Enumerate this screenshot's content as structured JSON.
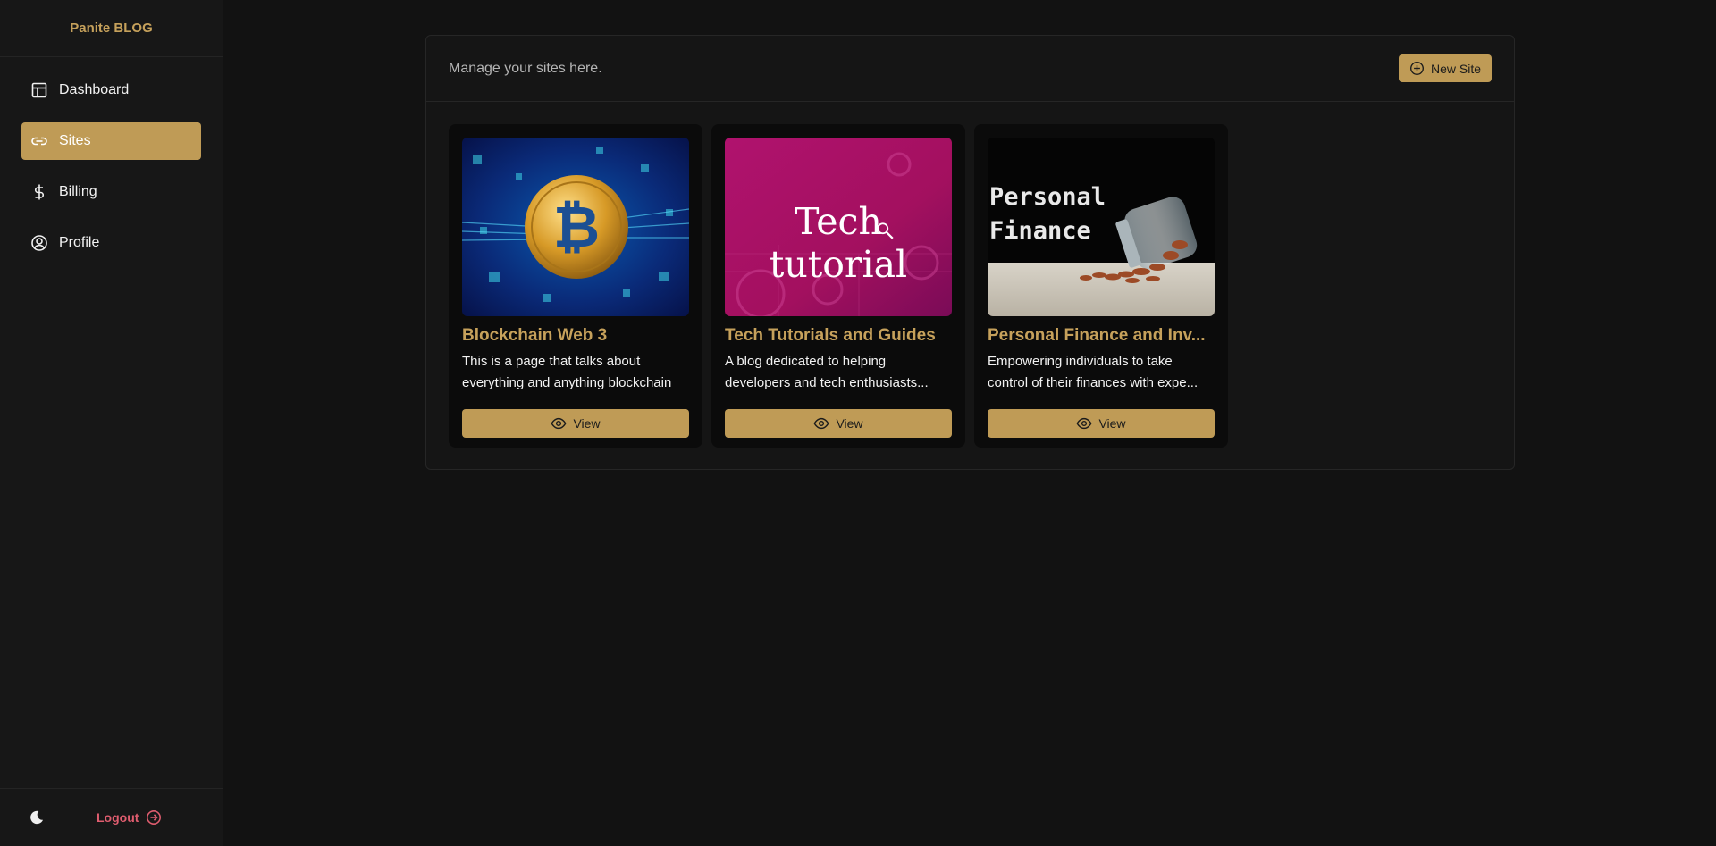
{
  "brand": "Panite BLOG",
  "colors": {
    "accent": "#bf9b56",
    "title_gold": "#c6a15b",
    "logout": "#e05d6f",
    "background": "#121212"
  },
  "sidebar": {
    "items": [
      {
        "label": "Dashboard",
        "icon": "layout-icon",
        "active": false
      },
      {
        "label": "Sites",
        "icon": "link-icon",
        "active": true
      },
      {
        "label": "Billing",
        "icon": "dollar-icon",
        "active": false
      },
      {
        "label": "Profile",
        "icon": "user-circle-icon",
        "active": false
      }
    ],
    "footer": {
      "theme_icon": "moon-icon",
      "logout_label": "Logout",
      "logout_icon": "arrow-right-circle-icon"
    }
  },
  "main": {
    "subtitle": "Manage your sites here.",
    "new_site_label": "New Site",
    "new_site_icon": "plus-circle-icon",
    "sites": [
      {
        "title": "Blockchain Web 3",
        "description": "This is a page that talks about everything and anything blockchain",
        "image": "bitcoin-image",
        "button_label": "View"
      },
      {
        "title": "Tech Tutorials and Guides",
        "description": "A blog dedicated to helping developers and tech enthusiasts...",
        "image": "tech-tutorial-image",
        "image_text": "Tech tutorial",
        "button_label": "View"
      },
      {
        "title": "Personal Finance and Inv...",
        "description": "Empowering individuals to take control of their finances with expe...",
        "image": "coin-jar-image",
        "image_text_line1": "Personal",
        "image_text_line2": "Finance",
        "button_label": "View"
      }
    ]
  }
}
